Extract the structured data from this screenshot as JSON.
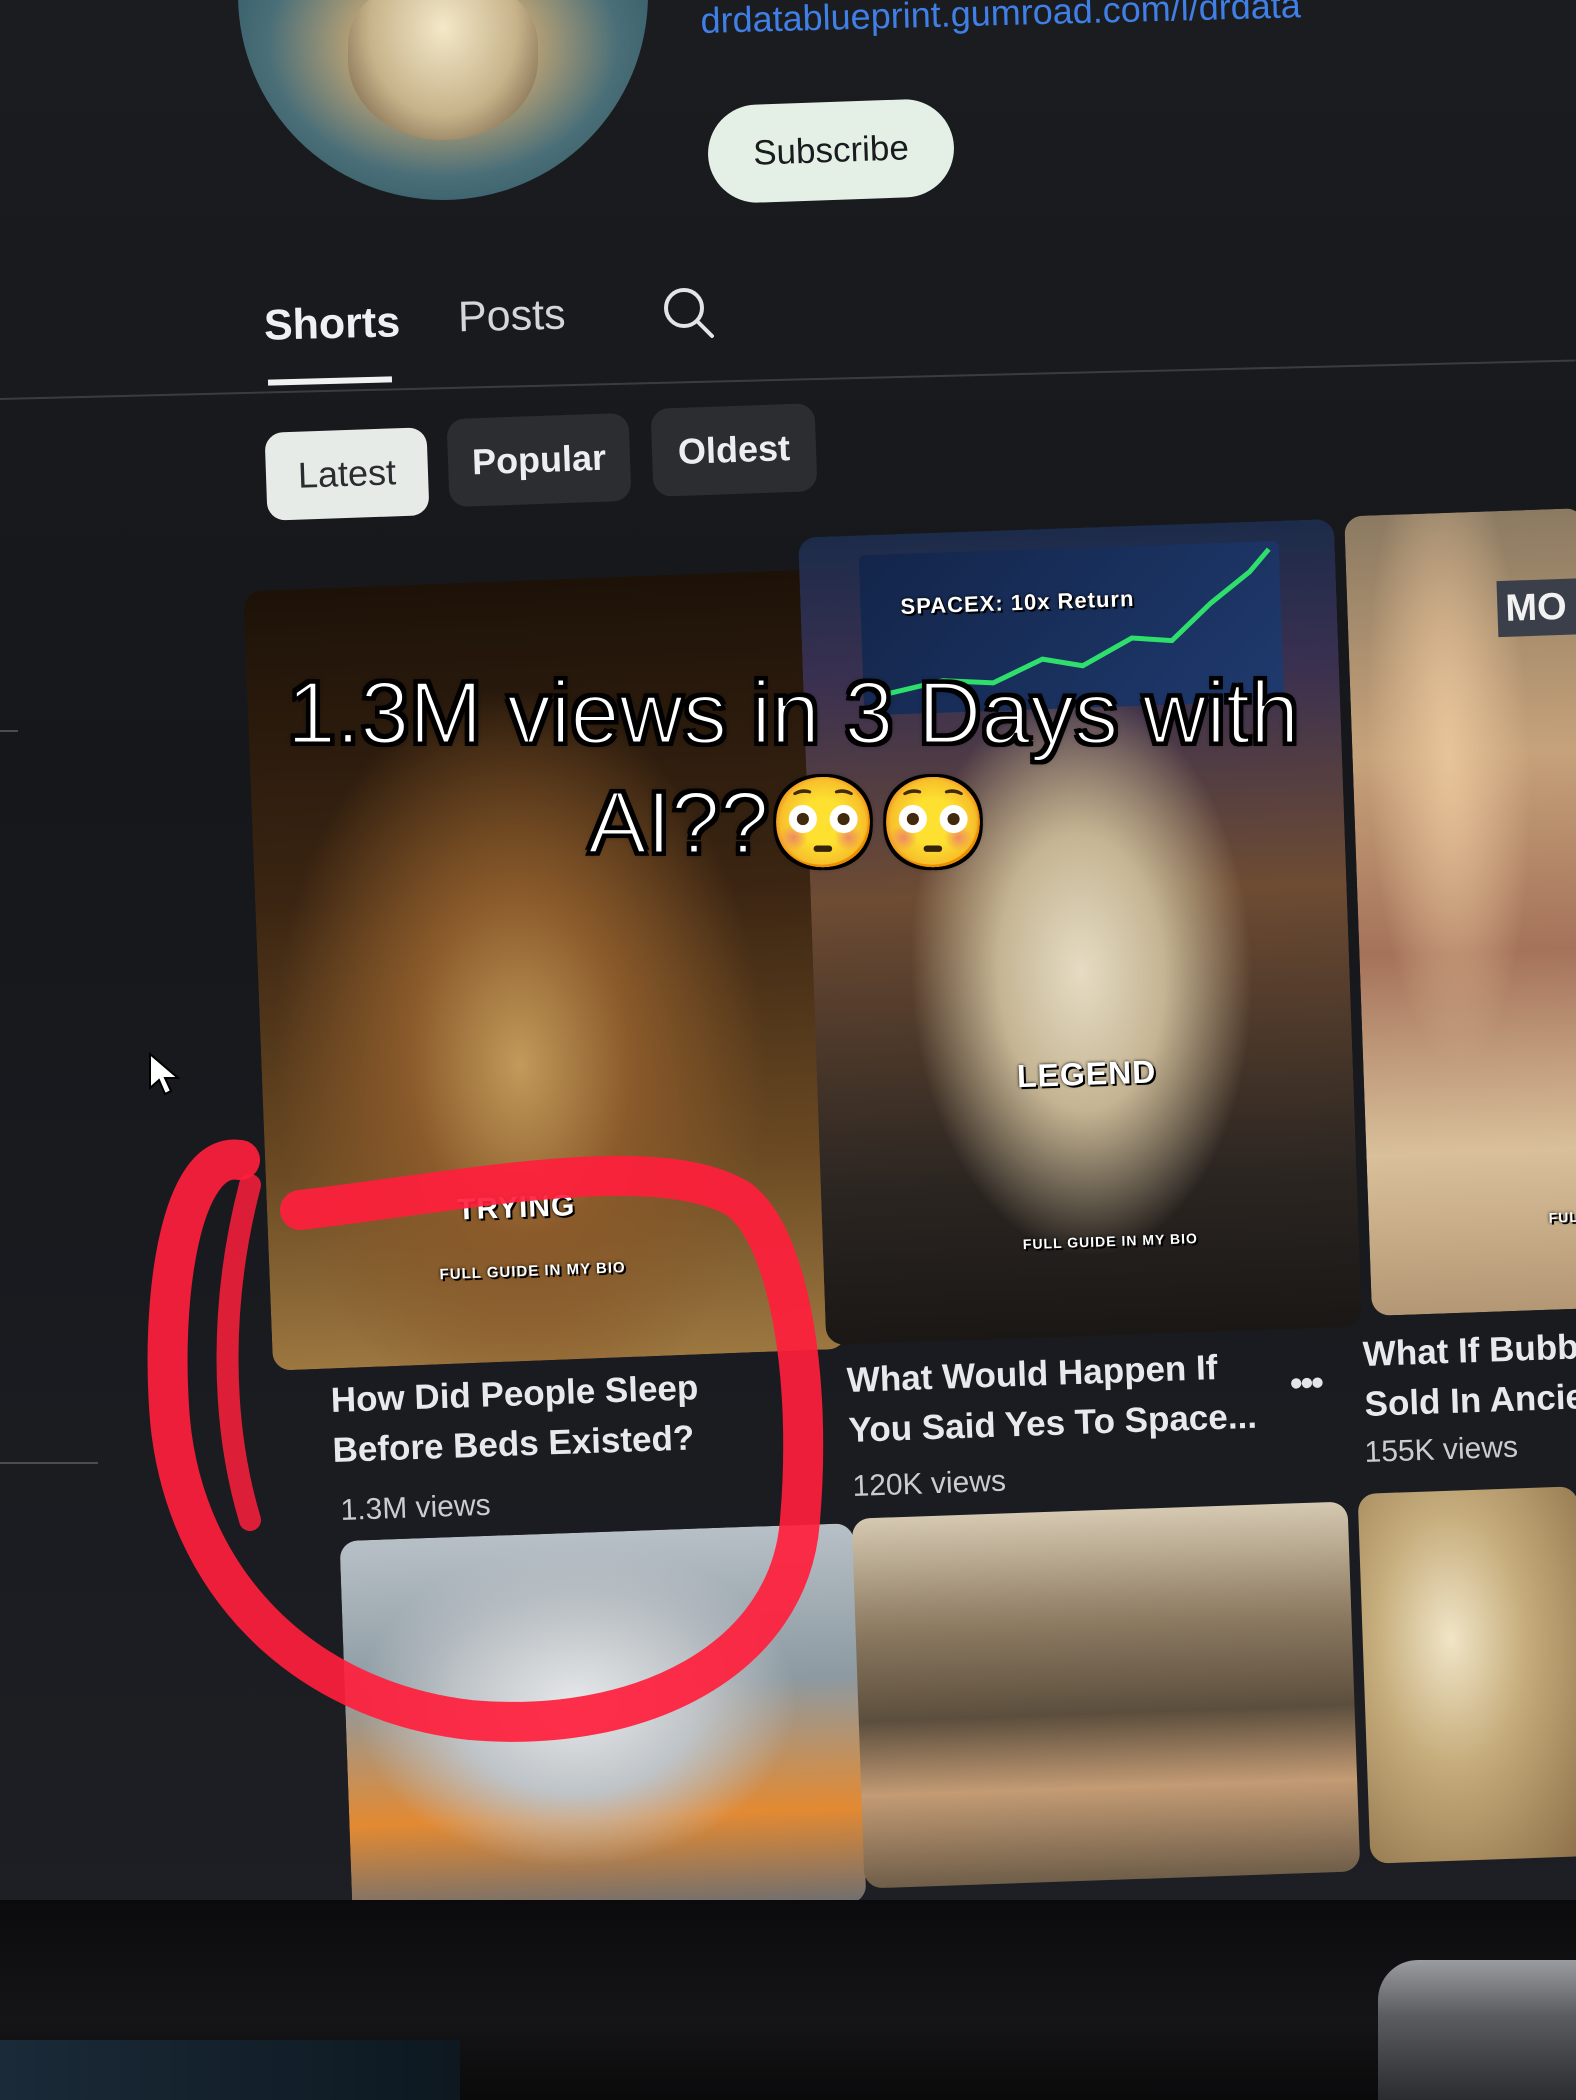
{
  "channel": {
    "link": "drdatablueprint.gumroad.com/l/drdata",
    "subscribe_label": "Subscribe"
  },
  "tabs": [
    {
      "label": "Shorts",
      "active": true
    },
    {
      "label": "Posts",
      "active": false
    }
  ],
  "search_icon": "search-icon",
  "filters": [
    {
      "label": "Latest",
      "active": true
    },
    {
      "label": "Popular",
      "active": false
    },
    {
      "label": "Oldest",
      "active": false
    }
  ],
  "videos": [
    {
      "overlay_text": "TRYING",
      "overlay_sub": "FULL GUIDE IN MY BIO",
      "title_line1": "How Did People Sleep",
      "title_line2": "Before Beds Existed?",
      "views": "1.3M views"
    },
    {
      "overlay_banner": "SPACEX: 10x Return",
      "overlay_text": "LEGEND",
      "overlay_sub": "FULL GUIDE IN MY BIO",
      "title_line1": "What Would Happen If",
      "title_line2": "You Said Yes To Space...",
      "views": "120K views"
    },
    {
      "overlay_text": "MO",
      "overlay_sub": "FULL",
      "title_line1": "What If Bubb",
      "title_line2": "Sold In Ancie",
      "views": "155K views"
    }
  ],
  "more_icon": "more-vert-icon",
  "caption": {
    "line1": "1.3M views in 3 Days with",
    "line2": "AI??😳😳"
  },
  "colors": {
    "background": "#16171b",
    "link": "#3f7fe6",
    "subscribe_bg": "#e4f0e6",
    "chip_active": "#e6ebe8",
    "chip_inactive": "#2b2d31",
    "annotation_red": "#ff1e3c"
  }
}
